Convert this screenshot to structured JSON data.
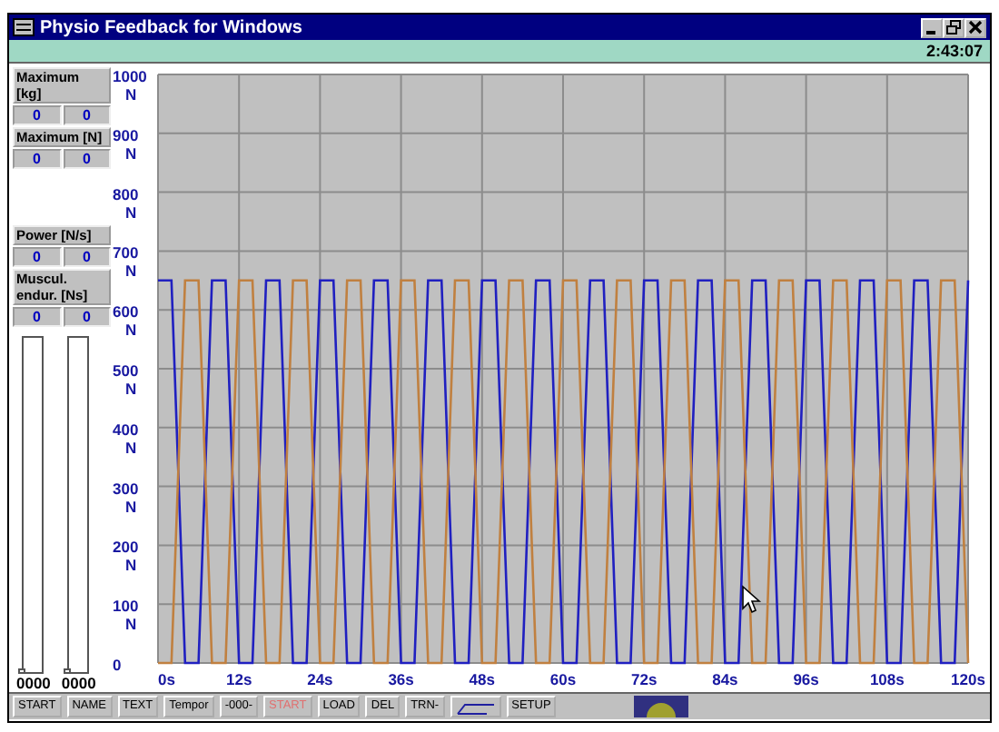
{
  "window": {
    "title": "Physio Feedback for Windows"
  },
  "status": {
    "time": "2:43:07"
  },
  "panels": [
    {
      "title": "Maximum [kg]",
      "values": [
        "0",
        "0"
      ]
    },
    {
      "title": "Maximum [N]",
      "values": [
        "0",
        "0"
      ]
    },
    {
      "title": "Power [N/s]",
      "values": [
        "0",
        "0"
      ]
    },
    {
      "title": "Muscul. endur. [Ns]",
      "values": [
        "0",
        "0"
      ]
    }
  ],
  "meters": [
    {
      "level": 0,
      "reading": "0000"
    },
    {
      "level": 0,
      "reading": "0000"
    }
  ],
  "chart": {
    "chart_data": {
      "type": "line",
      "grid": true,
      "x": [
        0,
        2,
        4,
        6,
        8,
        10,
        12,
        14,
        16,
        18,
        20,
        22,
        24,
        26,
        28,
        30,
        32,
        34,
        36,
        38,
        40,
        42,
        44,
        46,
        48,
        50,
        52,
        54,
        56,
        58,
        60,
        62,
        64,
        66,
        68,
        70,
        72,
        74,
        76,
        78,
        80,
        82,
        84,
        86,
        88,
        90,
        92,
        94,
        96,
        98,
        100,
        102,
        104,
        106,
        108,
        110,
        112,
        114,
        116,
        118,
        120
      ],
      "xlim": [
        0,
        120
      ],
      "ylim": [
        0,
        1000
      ],
      "xticks": [
        {
          "value": 0,
          "label": "0s"
        },
        {
          "value": 12,
          "label": "12s"
        },
        {
          "value": 24,
          "label": "24s"
        },
        {
          "value": 36,
          "label": "36s"
        },
        {
          "value": 48,
          "label": "48s"
        },
        {
          "value": 60,
          "label": "60s"
        },
        {
          "value": 72,
          "label": "72s"
        },
        {
          "value": 84,
          "label": "84s"
        },
        {
          "value": 96,
          "label": "96s"
        },
        {
          "value": 108,
          "label": "108s"
        },
        {
          "value": 120,
          "label": "120s"
        }
      ],
      "yticks": [
        {
          "value": 0,
          "label": "0"
        },
        {
          "value": 100,
          "label": "100 N"
        },
        {
          "value": 200,
          "label": "200 N"
        },
        {
          "value": 300,
          "label": "300 N"
        },
        {
          "value": 400,
          "label": "400 N"
        },
        {
          "value": 500,
          "label": "500 N"
        },
        {
          "value": 600,
          "label": "600 N"
        },
        {
          "value": 700,
          "label": "700 N"
        },
        {
          "value": 800,
          "label": "800 N"
        },
        {
          "value": 900,
          "label": "900 N"
        },
        {
          "value": 1000,
          "label": "1000 N"
        }
      ],
      "series": [
        {
          "color": "#2020c0",
          "values": [
            650,
            650,
            0,
            0,
            650,
            650,
            0,
            0,
            650,
            650,
            0,
            0,
            650,
            650,
            0,
            0,
            650,
            650,
            0,
            0,
            650,
            650,
            0,
            0,
            650,
            650,
            0,
            0,
            650,
            650,
            0,
            0,
            650,
            650,
            0,
            0,
            650,
            650,
            0,
            0,
            650,
            650,
            0,
            0,
            650,
            650,
            0,
            0,
            650,
            650,
            0,
            0,
            650,
            650,
            0,
            0,
            650,
            650,
            0,
            0,
            650
          ]
        },
        {
          "color": "#c08040",
          "values": [
            0,
            0,
            650,
            650,
            0,
            0,
            650,
            650,
            0,
            0,
            650,
            650,
            0,
            0,
            650,
            650,
            0,
            0,
            650,
            650,
            0,
            0,
            650,
            650,
            0,
            0,
            650,
            650,
            0,
            0,
            650,
            650,
            0,
            0,
            650,
            650,
            0,
            0,
            650,
            650,
            0,
            0,
            650,
            650,
            0,
            0,
            650,
            650,
            0,
            0,
            650,
            650,
            0,
            0,
            650,
            650,
            0,
            0,
            650,
            650,
            0
          ]
        }
      ]
    }
  },
  "toolbar": [
    {
      "kind": "button",
      "label": "START",
      "disabled": false
    },
    {
      "kind": "button",
      "label": "NAME",
      "disabled": false
    },
    {
      "kind": "button",
      "label": "TEXT",
      "disabled": false
    },
    {
      "kind": "button",
      "label": "Tempor",
      "disabled": false
    },
    {
      "kind": "button",
      "label": "-000-",
      "disabled": false
    },
    {
      "kind": "button",
      "label": "START",
      "disabled": true
    },
    {
      "kind": "button",
      "label": "LOAD",
      "disabled": false
    },
    {
      "kind": "button",
      "label": "DEL",
      "disabled": false
    },
    {
      "kind": "button",
      "label": "TRN-",
      "disabled": false
    },
    {
      "kind": "icon",
      "disabled": false
    },
    {
      "kind": "button",
      "label": "SETUP",
      "disabled": false
    },
    {
      "kind": "indicator",
      "disabled": false
    }
  ]
}
